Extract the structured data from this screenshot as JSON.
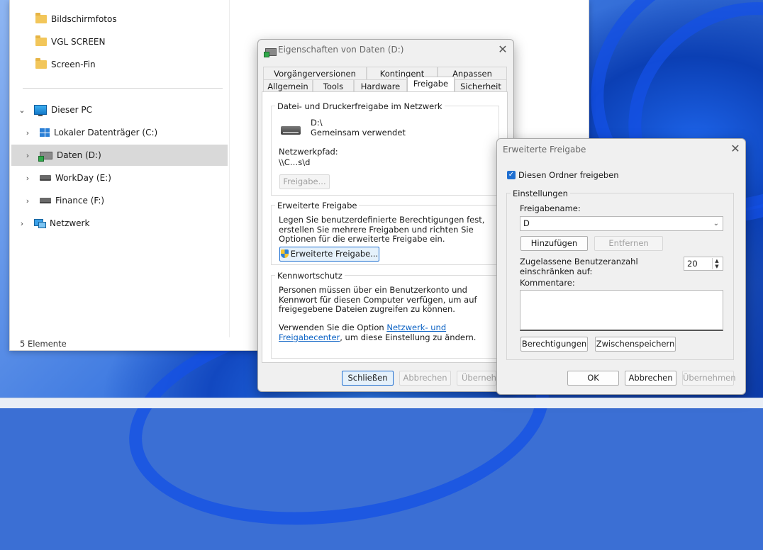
{
  "explorer": {
    "nav_items": [
      {
        "label": "Bildschirmfotos",
        "icon": "folder-icon"
      },
      {
        "label": "VGL SCREEN",
        "icon": "folder-icon"
      },
      {
        "label": "Screen-Fin",
        "icon": "folder-icon"
      },
      {
        "label": "Dieser PC",
        "icon": "computer-icon"
      },
      {
        "label": "Lokaler Datenträger (C:)",
        "icon": "windows-drive-icon"
      },
      {
        "label": "Daten (D:)",
        "icon": "network-drive-icon"
      },
      {
        "label": "WorkDay (E:)",
        "icon": "drive-icon"
      },
      {
        "label": "Finance (F:)",
        "icon": "drive-icon"
      },
      {
        "label": "Netzwerk",
        "icon": "network-icon"
      }
    ],
    "selected": "Daten (D:)",
    "status": "5 Elemente"
  },
  "properties": {
    "title": "Eigenschaften von Daten (D:)",
    "tabs_row1": [
      "Vorgängerversionen",
      "Kontingent",
      "Anpassen"
    ],
    "tabs_row2": [
      "Allgemein",
      "Tools",
      "Hardware",
      "Freigabe",
      "Sicherheit"
    ],
    "active_tab": "Freigabe",
    "network_share": {
      "legend": "Datei- und Druckerfreigabe im Netzwerk",
      "drive": "D:\\",
      "state": "Gemeinsam verwendet",
      "path_label": "Netzwerkpfad:",
      "path_value": "\\\\C…s\\d",
      "share_button": "Freigabe..."
    },
    "advanced_share": {
      "legend": "Erweiterte Freigabe",
      "description": "Legen Sie benutzerdefinierte Berechtigungen fest, erstellen Sie mehrere Freigaben und richten Sie Optionen für die erweiterte Freigabe ein.",
      "button": "Erweiterte Freigabe..."
    },
    "password": {
      "legend": "Kennwortschutz",
      "description": "Personen müssen über ein Benutzerkonto und Kennwort für diesen Computer verfügen, um auf freigegebene Dateien zugreifen zu können.",
      "option_prefix": "Verwenden Sie die Option ",
      "option_link": "Netzwerk- und Freigabecenter",
      "option_suffix": ", um diese Einstellung zu ändern."
    },
    "buttons": {
      "close": "Schließen",
      "cancel": "Abbrechen",
      "apply": "Übernehmen"
    }
  },
  "advanced": {
    "title": "Erweiterte Freigabe",
    "share_checkbox": "Diesen Ordner freigeben",
    "share_checked": true,
    "settings_legend": "Einstellungen",
    "share_name_label": "Freigabename:",
    "share_name_value": "D",
    "add_button": "Hinzufügen",
    "remove_button": "Entfernen",
    "limit_label": "Zugelassene Benutzeranzahl einschränken auf:",
    "limit_value": "20",
    "comments_label": "Kommentare:",
    "comments_value": "",
    "permissions_button": "Berechtigungen",
    "caching_button": "Zwischenspeichern",
    "buttons": {
      "ok": "OK",
      "cancel": "Abbrechen",
      "apply": "Übernehmen"
    }
  },
  "colors": {
    "accent": "#1f6fd1",
    "link": "#0b62c4",
    "selection": "#d9d9d9"
  }
}
